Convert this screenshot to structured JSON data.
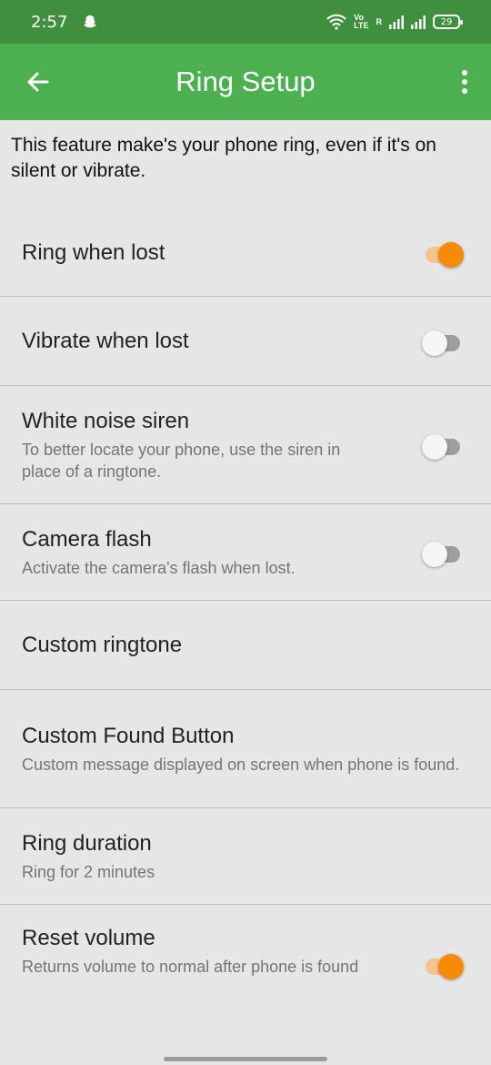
{
  "status_bar": {
    "time": "2:57",
    "volte": "Vo",
    "lte": "LTE",
    "r_label": "R",
    "battery": "29"
  },
  "app_bar": {
    "title": "Ring Setup",
    "back_icon": "arrow-left-icon",
    "menu_icon": "more-vert-icon"
  },
  "intro": "This feature make's your phone ring, even if it's on silent or vibrate.",
  "settings": [
    {
      "label": "Ring when lost",
      "sub": "",
      "toggle": true
    },
    {
      "label": "Vibrate when lost",
      "sub": "",
      "toggle": false
    },
    {
      "label": "White noise siren",
      "sub": "To better locate your phone, use the siren in place of a ringtone.",
      "toggle": false
    },
    {
      "label": "Camera flash",
      "sub": "Activate the camera's flash when lost.",
      "toggle": false
    },
    {
      "label": "Custom ringtone",
      "sub": ""
    },
    {
      "label": "Custom Found Button",
      "sub": "Custom message displayed on screen when phone is found."
    },
    {
      "label": "Ring duration",
      "sub": "Ring for 2 minutes"
    },
    {
      "label": "Reset volume",
      "sub": "Returns volume to normal after phone is found",
      "toggle": true
    }
  ],
  "colors": {
    "status_bar": "#3f8f3e",
    "app_bar": "#4cb050",
    "accent": "#f78b07",
    "background": "#e6e6e6"
  }
}
